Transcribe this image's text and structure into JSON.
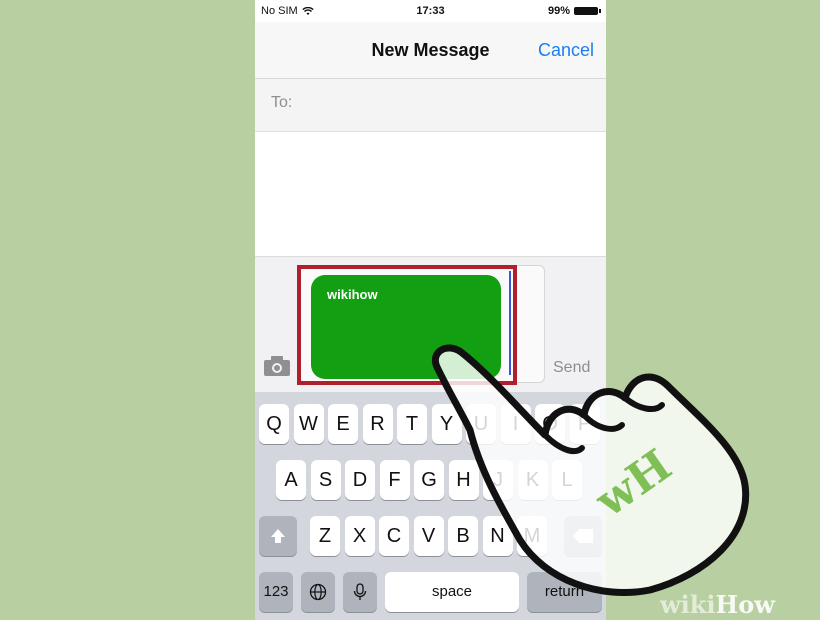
{
  "status_bar": {
    "carrier": "No SIM",
    "wifi_icon": "wifi-icon",
    "time": "17:33",
    "battery": "99%"
  },
  "nav": {
    "title": "New Message",
    "cancel_label": "Cancel"
  },
  "to_field": {
    "label": "To:"
  },
  "composer": {
    "attachment_text": "wikihow",
    "send_label": "Send",
    "camera_icon": "camera-icon"
  },
  "keyboard": {
    "row1": [
      "Q",
      "W",
      "E",
      "R",
      "T",
      "Y",
      "U",
      "I",
      "O",
      "P"
    ],
    "row2": [
      "A",
      "S",
      "D",
      "F",
      "G",
      "H",
      "J",
      "K",
      "L"
    ],
    "row3": [
      "Z",
      "X",
      "C",
      "V",
      "B",
      "N",
      "M"
    ],
    "shift_icon": "shift-icon",
    "delete_icon": "delete-icon",
    "numbers_label": "123",
    "globe_icon": "globe-icon",
    "mic_icon": "microphone-icon",
    "space_label": "space",
    "return_label": "return"
  },
  "watermark": {
    "logo": "wH",
    "brand_wiki": "wiki",
    "brand_how": "How"
  },
  "colors": {
    "background": "#b7cfa1",
    "accent": "#1a7ff0",
    "highlight": "#b0202c",
    "green_pad": "#12a012"
  }
}
